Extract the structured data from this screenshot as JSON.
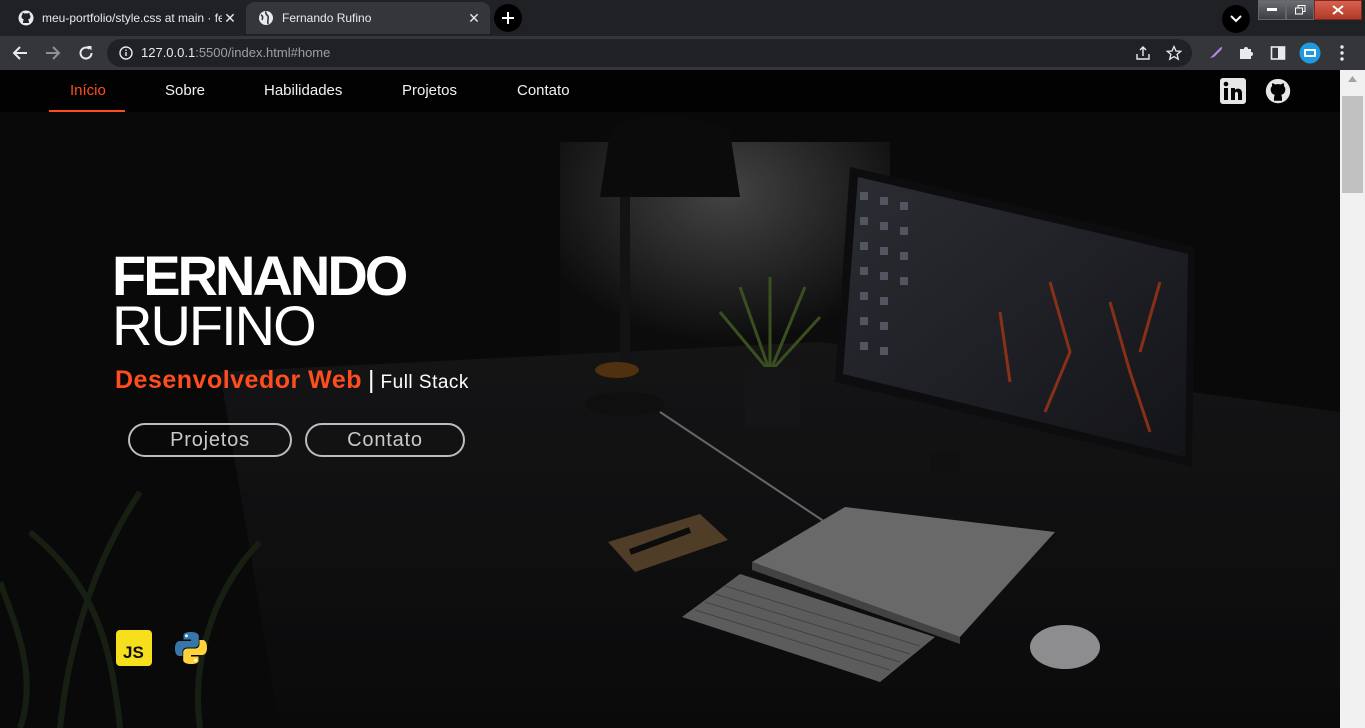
{
  "browser": {
    "tabs": [
      {
        "title": "meu-portfolio/style.css at main · fernandorufino",
        "favicon": "github-icon",
        "active": false
      },
      {
        "title": "Fernando Rufino",
        "favicon": "globe-icon",
        "active": true
      }
    ],
    "address": {
      "host": "127.0.0.1",
      "rest": ":5500/index.html#home"
    }
  },
  "site_nav": {
    "links": [
      "Início",
      "Sobre",
      "Habilidades",
      "Projetos",
      "Contato"
    ],
    "active_index": 0,
    "social_icons": [
      "linkedin-icon",
      "github-icon"
    ]
  },
  "hero": {
    "first_name": "FERNANDO",
    "last_name": "RUFINO",
    "role": "Desenvolvedor Web",
    "separator": "|",
    "stack": "Full Stack",
    "buttons": [
      "Projetos",
      "Contato"
    ],
    "skills": [
      {
        "icon": "javascript-icon",
        "label": "JS"
      },
      {
        "icon": "python-icon"
      }
    ]
  },
  "colors": {
    "accent": "#ff4d1f",
    "nav_bg": "#020202",
    "chrome_dark": "#202124",
    "chrome_toolbar": "#35363a"
  }
}
